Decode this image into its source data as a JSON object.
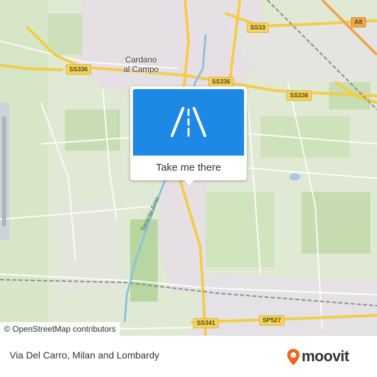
{
  "map": {
    "places": {
      "cardano": "Cardano\nal Campo"
    },
    "roads": {
      "ss336_left": "SS336",
      "ss336_mid": "SS336",
      "ss336_right": "SS336",
      "ss33": "SS33",
      "a8": "A8",
      "ss341": "SS341",
      "sp527": "SP527"
    },
    "river": "Torrente Arno",
    "attribution": "© OpenStreetMap contributors"
  },
  "popup": {
    "icon": "road-icon",
    "button_label": "Take me there",
    "accent": "#1e88e5"
  },
  "footer": {
    "title": "Via Del Carro, Milan and Lombardy",
    "brand": "moovit",
    "brand_color": "#f26522"
  }
}
